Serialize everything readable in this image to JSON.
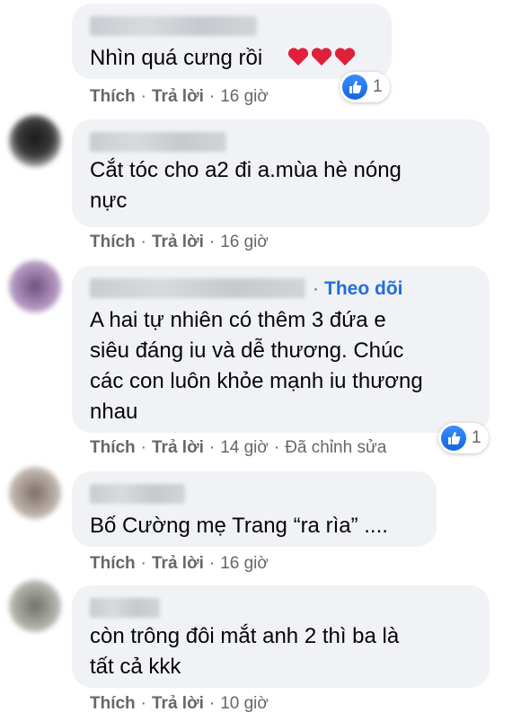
{
  "comments": [
    {
      "text": "Nhìn quá cưng rồi",
      "actions": {
        "like": "Thích",
        "reply": "Trả lời",
        "time": "16 giờ"
      },
      "reaction_count": "1",
      "avatar_color": "#ffffff"
    },
    {
      "text": "Cắt tóc cho a2 đi a.mùa hè nóng\nnực",
      "actions": {
        "like": "Thích",
        "reply": "Trả lời",
        "time": "16 giờ"
      },
      "avatar_color": "#3a3a3a"
    },
    {
      "follow_label": "Theo dõi",
      "text": "A hai tự nhiên có thêm 3 đứa e\nsiêu đáng iu và dễ thương. Chúc\ncác con luôn khỏe mạnh iu thương\nnhau",
      "actions": {
        "like": "Thích",
        "reply": "Trả lời",
        "time": "14 giờ",
        "edited": "Đã chỉnh sửa"
      },
      "reaction_count": "1",
      "avatar_color": "#8c6f9a"
    },
    {
      "text": "Bố Cường mẹ Trang “ra rìa” ....",
      "actions": {
        "like": "Thích",
        "reply": "Trả lời",
        "time": "16 giờ"
      },
      "avatar_color": "#9a8f86"
    },
    {
      "text": "còn trông đôi mắt anh 2 thì ba là\ntất cả kkk",
      "actions": {
        "like": "Thích",
        "reply": "Trả lời",
        "time": "10 giờ"
      },
      "avatar_color": "#8c8f86"
    }
  ],
  "colors": {
    "bubble": "#f0f2f5",
    "muted": "#65676b",
    "link": "#216fdb",
    "heart": "#e0203a"
  },
  "icons": [
    "like-icon",
    "heart-icon",
    "avatar"
  ]
}
